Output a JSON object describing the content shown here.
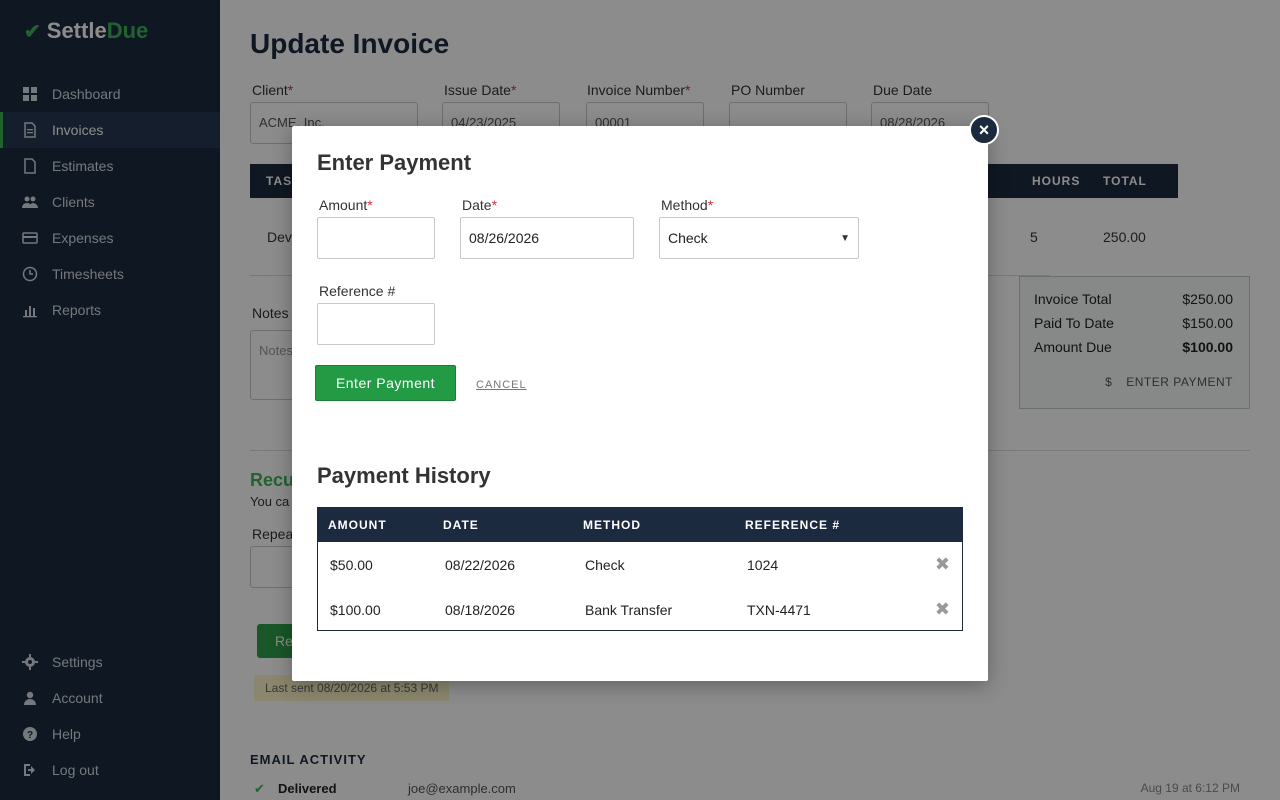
{
  "app": {
    "brand_part1": "Settle",
    "brand_part2": "Due"
  },
  "sidebar": {
    "items": [
      {
        "label": "Dashboard",
        "icon": "dashboard-icon"
      },
      {
        "label": "Invoices",
        "icon": "invoice-icon",
        "active": true
      },
      {
        "label": "Estimates",
        "icon": "estimate-icon"
      },
      {
        "label": "Clients",
        "icon": "clients-icon"
      },
      {
        "label": "Expenses",
        "icon": "card-icon"
      },
      {
        "label": "Timesheets",
        "icon": "clock-icon"
      },
      {
        "label": "Reports",
        "icon": "chart-icon"
      }
    ],
    "bottom_items": [
      {
        "label": "Settings",
        "icon": "gear-icon"
      },
      {
        "label": "Account",
        "icon": "user-icon"
      },
      {
        "label": "Help",
        "icon": "help-icon"
      },
      {
        "label": "Log out",
        "icon": "logout-icon"
      }
    ]
  },
  "page": {
    "title": "Update Invoice",
    "fields": {
      "client_label": "Client",
      "client_value": "ACME, Inc.",
      "issue_date_label": "Issue Date",
      "issue_date_value": "04/23/2025",
      "invoice_number_label": "Invoice Number",
      "invoice_number_value": "00001",
      "po_number_label": "PO Number",
      "due_date_label": "Due Date",
      "due_date_value": "08/28/2026"
    },
    "table": {
      "col_task": "TAS",
      "col_hours": "HOURS",
      "col_total": "TOTAL",
      "row_task": "Dev",
      "row_hours": "5",
      "row_total": "250.00"
    },
    "notes_label": "Notes",
    "notes_placeholder": "Notes",
    "summary": {
      "invoice_total_label": "Invoice Total",
      "invoice_total_value": "$250.00",
      "paid_label": "Paid To Date",
      "paid_value": "$150.00",
      "due_label": "Amount Due",
      "due_value": "$100.00",
      "enter_payment": "ENTER PAYMENT"
    },
    "recurring_title": "Recu",
    "recurring_text": "You ca",
    "repeat_label": "Repea",
    "send_button": "Re",
    "last_sent": "Last sent 08/20/2026 at 5:53 PM",
    "email_activity": {
      "heading": "EMAIL ACTIVITY",
      "status": "Delivered",
      "email": "joe@example.com",
      "time": "Aug 19 at 6:12 PM"
    }
  },
  "modal": {
    "title": "Enter Payment",
    "amount_label": "Amount",
    "amount_value": "",
    "date_label": "Date",
    "date_value": "08/26/2026",
    "method_label": "Method",
    "method_value": "Check",
    "reference_label": "Reference #",
    "reference_value": "",
    "submit_label": "Enter Payment",
    "cancel_label": "CANCEL",
    "history_title": "Payment History",
    "history_columns": [
      "AMOUNT",
      "DATE",
      "METHOD",
      "REFERENCE #"
    ],
    "history_rows": [
      {
        "amount": "$50.00",
        "date": "08/22/2026",
        "method": "Check",
        "reference": "1024"
      },
      {
        "amount": "$100.00",
        "date": "08/18/2026",
        "method": "Bank Transfer",
        "reference": "TXN-4471"
      }
    ]
  },
  "colors": {
    "navy": "#1c2a3f",
    "green": "#3fb35a",
    "button_green": "#239b45",
    "required": "#d42f2f"
  }
}
